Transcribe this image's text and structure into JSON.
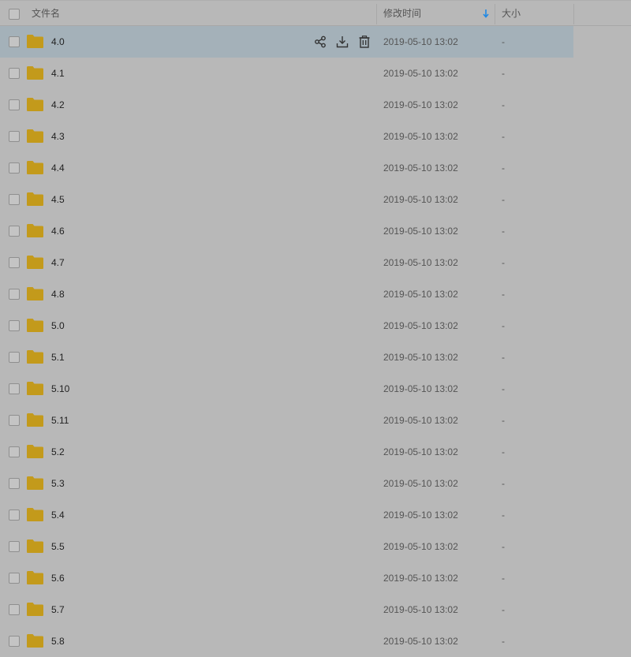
{
  "header": {
    "name_label": "文件名",
    "time_label": "修改时间",
    "size_label": "大小",
    "sort_icon": "arrow-down-icon",
    "sort_color": "#1e88e5"
  },
  "folder_color": "#c39a1c",
  "row_actions": [
    "share-icon",
    "download-icon",
    "delete-icon"
  ],
  "files": [
    {
      "name": "4.0",
      "modified": "2019-05-10 13:02",
      "size": "-",
      "highlighted": true
    },
    {
      "name": "4.1",
      "modified": "2019-05-10 13:02",
      "size": "-"
    },
    {
      "name": "4.2",
      "modified": "2019-05-10 13:02",
      "size": "-"
    },
    {
      "name": "4.3",
      "modified": "2019-05-10 13:02",
      "size": "-"
    },
    {
      "name": "4.4",
      "modified": "2019-05-10 13:02",
      "size": "-"
    },
    {
      "name": "4.5",
      "modified": "2019-05-10 13:02",
      "size": "-"
    },
    {
      "name": "4.6",
      "modified": "2019-05-10 13:02",
      "size": "-"
    },
    {
      "name": "4.7",
      "modified": "2019-05-10 13:02",
      "size": "-"
    },
    {
      "name": "4.8",
      "modified": "2019-05-10 13:02",
      "size": "-"
    },
    {
      "name": "5.0",
      "modified": "2019-05-10 13:02",
      "size": "-"
    },
    {
      "name": "5.1",
      "modified": "2019-05-10 13:02",
      "size": "-"
    },
    {
      "name": "5.10",
      "modified": "2019-05-10 13:02",
      "size": "-"
    },
    {
      "name": "5.11",
      "modified": "2019-05-10 13:02",
      "size": "-"
    },
    {
      "name": "5.2",
      "modified": "2019-05-10 13:02",
      "size": "-"
    },
    {
      "name": "5.3",
      "modified": "2019-05-10 13:02",
      "size": "-"
    },
    {
      "name": "5.4",
      "modified": "2019-05-10 13:02",
      "size": "-"
    },
    {
      "name": "5.5",
      "modified": "2019-05-10 13:02",
      "size": "-"
    },
    {
      "name": "5.6",
      "modified": "2019-05-10 13:02",
      "size": "-"
    },
    {
      "name": "5.7",
      "modified": "2019-05-10 13:02",
      "size": "-"
    },
    {
      "name": "5.8",
      "modified": "2019-05-10 13:02",
      "size": "-"
    }
  ]
}
